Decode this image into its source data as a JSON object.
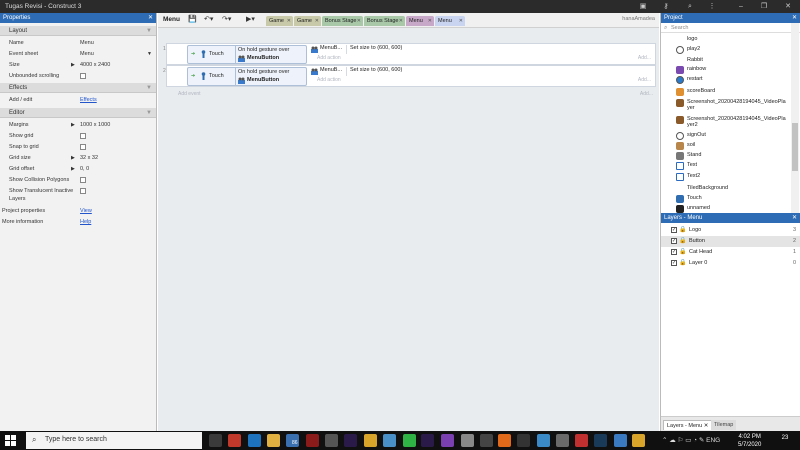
{
  "window": {
    "title": "Tugas Revisi - Construct 3"
  },
  "properties_panel": {
    "title": "Properties",
    "sections": {
      "layout": "Layout",
      "effects": "Effects",
      "editor": "Editor"
    },
    "layout_rows": [
      {
        "key": "Name",
        "value": "Menu"
      },
      {
        "key": "Event sheet",
        "value": "Menu"
      },
      {
        "key": "Size",
        "value": "4000 x 2400"
      },
      {
        "key": "Unbounded scrolling",
        "value": ""
      }
    ],
    "effects_rows": [
      {
        "key": "Add / edit",
        "value": "Effects"
      }
    ],
    "editor_rows": [
      {
        "key": "Margins",
        "value": "1000 x 1000"
      },
      {
        "key": "Show grid",
        "value": ""
      },
      {
        "key": "Snap to grid",
        "value": ""
      },
      {
        "key": "Grid size",
        "value": "32 x 32"
      },
      {
        "key": "Grid offset",
        "value": "0, 0"
      },
      {
        "key": "Show Collision Polygons",
        "value": ""
      },
      {
        "key": "Show Translucent Inactive Layers",
        "value": ""
      }
    ],
    "footer_rows": [
      {
        "key": "Project properties",
        "value": "View"
      },
      {
        "key": "More information",
        "value": "Help"
      }
    ]
  },
  "toolbar": {
    "title": "Menu",
    "save_icon": "save-icon",
    "undo_icon": "undo-icon",
    "redo_icon": "redo-icon",
    "play_icon": "play-icon",
    "user": "hanaAmadea",
    "tabs": [
      {
        "label": "Game",
        "color": "#c8c9a8"
      },
      {
        "label": "Game",
        "color": "#c8c9a8"
      },
      {
        "label": "Bonus Stage",
        "color": "#a8c8a8"
      },
      {
        "label": "Bonus Stage",
        "color": "#a8c8a8"
      },
      {
        "label": "Menu",
        "color": "#c8a8c8"
      },
      {
        "label": "Menu",
        "color": "#c8d4f0"
      }
    ]
  },
  "events": {
    "rows": [
      {
        "number": "1",
        "object": "Touch",
        "cond_line1": "On hold gesture over",
        "cond_line2": "MenuButton",
        "action_object": "MenuB...",
        "action_text": "Set size to (600, 600)",
        "add_action": "Add action",
        "add": "Add..."
      },
      {
        "number": "2",
        "object": "Touch",
        "cond_line1": "On hold gesture over",
        "cond_line2": "MenuButton",
        "action_object": "MenuB...",
        "action_text": "Set size to (600, 600)",
        "add_action": "Add action",
        "add": "Add..."
      }
    ],
    "add_event": "Add event",
    "add_right": "Add..."
  },
  "project_panel": {
    "title": "Project",
    "search_placeholder": "Search",
    "items": [
      {
        "label": "logo",
        "icon": "blank-icon"
      },
      {
        "label": "play2",
        "icon": "play2-icon"
      },
      {
        "label": "Rabbit",
        "icon": "blank-icon"
      },
      {
        "label": "rainbow",
        "icon": "rainbow-icon"
      },
      {
        "label": "restart",
        "icon": "restart-icon"
      },
      {
        "label": "scoreBoard",
        "icon": "scoreboard-icon"
      },
      {
        "label": "Screenshot_20200428194045_VideoPlayer",
        "icon": "image-icon"
      },
      {
        "label": "Screenshot_20200428194045_VideoPlayer2",
        "icon": "image-icon"
      },
      {
        "label": "signOut",
        "icon": "signout-icon"
      },
      {
        "label": "soil",
        "icon": "soil-icon"
      },
      {
        "label": "Stand",
        "icon": "stand-icon"
      },
      {
        "label": "Text",
        "icon": "text-icon"
      },
      {
        "label": "Text2",
        "icon": "text-icon"
      },
      {
        "label": "TiledBackground",
        "icon": "blank-icon"
      },
      {
        "label": "Touch",
        "icon": "touch-icon"
      },
      {
        "label": "unnamed",
        "icon": "unnamed-icon"
      }
    ]
  },
  "layers_panel": {
    "title": "Layers - Menu",
    "layers": [
      {
        "name": "Logo",
        "index": "3"
      },
      {
        "name": "Button",
        "index": "2"
      },
      {
        "name": "Cat Head",
        "index": "1"
      },
      {
        "name": "Layer 0",
        "index": "0"
      }
    ],
    "bottom_tabs": [
      "Layers - Menu",
      "Tilemap"
    ]
  },
  "taskbar": {
    "search_placeholder": "Type here to search",
    "time": "4:02 PM",
    "date": "5/7/2020",
    "badge_86": "86",
    "notifications": "23",
    "apps": [
      {
        "name": "store-icon",
        "color": "#3a3a3a"
      },
      {
        "name": "construct-icon",
        "color": "#c0392b"
      },
      {
        "name": "edge-icon",
        "color": "#1e73be"
      },
      {
        "name": "explorer-icon",
        "color": "#e0b040"
      },
      {
        "name": "cloud-icon",
        "color": "#3a6fb0"
      },
      {
        "name": "video-icon",
        "color": "#8b1a1a"
      },
      {
        "name": "media-icon",
        "color": "#555555"
      },
      {
        "name": "premiere-icon",
        "color": "#2a1a4a"
      },
      {
        "name": "chrome-icon",
        "color": "#d9a42a"
      },
      {
        "name": "photos-icon",
        "color": "#4a90c8"
      },
      {
        "name": "line-icon",
        "color": "#2fb344"
      },
      {
        "name": "aftereffects-icon",
        "color": "#2a1a4a"
      },
      {
        "name": "vs-icon",
        "color": "#7a3fb0"
      },
      {
        "name": "settings-icon",
        "color": "#888888"
      },
      {
        "name": "steam-icon",
        "color": "#444444"
      },
      {
        "name": "firefox-icon",
        "color": "#e06a1a"
      },
      {
        "name": "unreal-icon",
        "color": "#333333"
      },
      {
        "name": "m-icon",
        "color": "#3a8ac8"
      },
      {
        "name": "screen-icon",
        "color": "#6a6a6a"
      },
      {
        "name": "player-icon",
        "color": "#c03030"
      },
      {
        "name": "photoshop-icon",
        "color": "#1a3a5a"
      },
      {
        "name": "globe-icon",
        "color": "#3a7ac0"
      },
      {
        "name": "chrome2-icon",
        "color": "#d9a42a"
      }
    ]
  },
  "colors": {
    "accent": "#2e6db5",
    "event_bg": "#e9ecef"
  }
}
